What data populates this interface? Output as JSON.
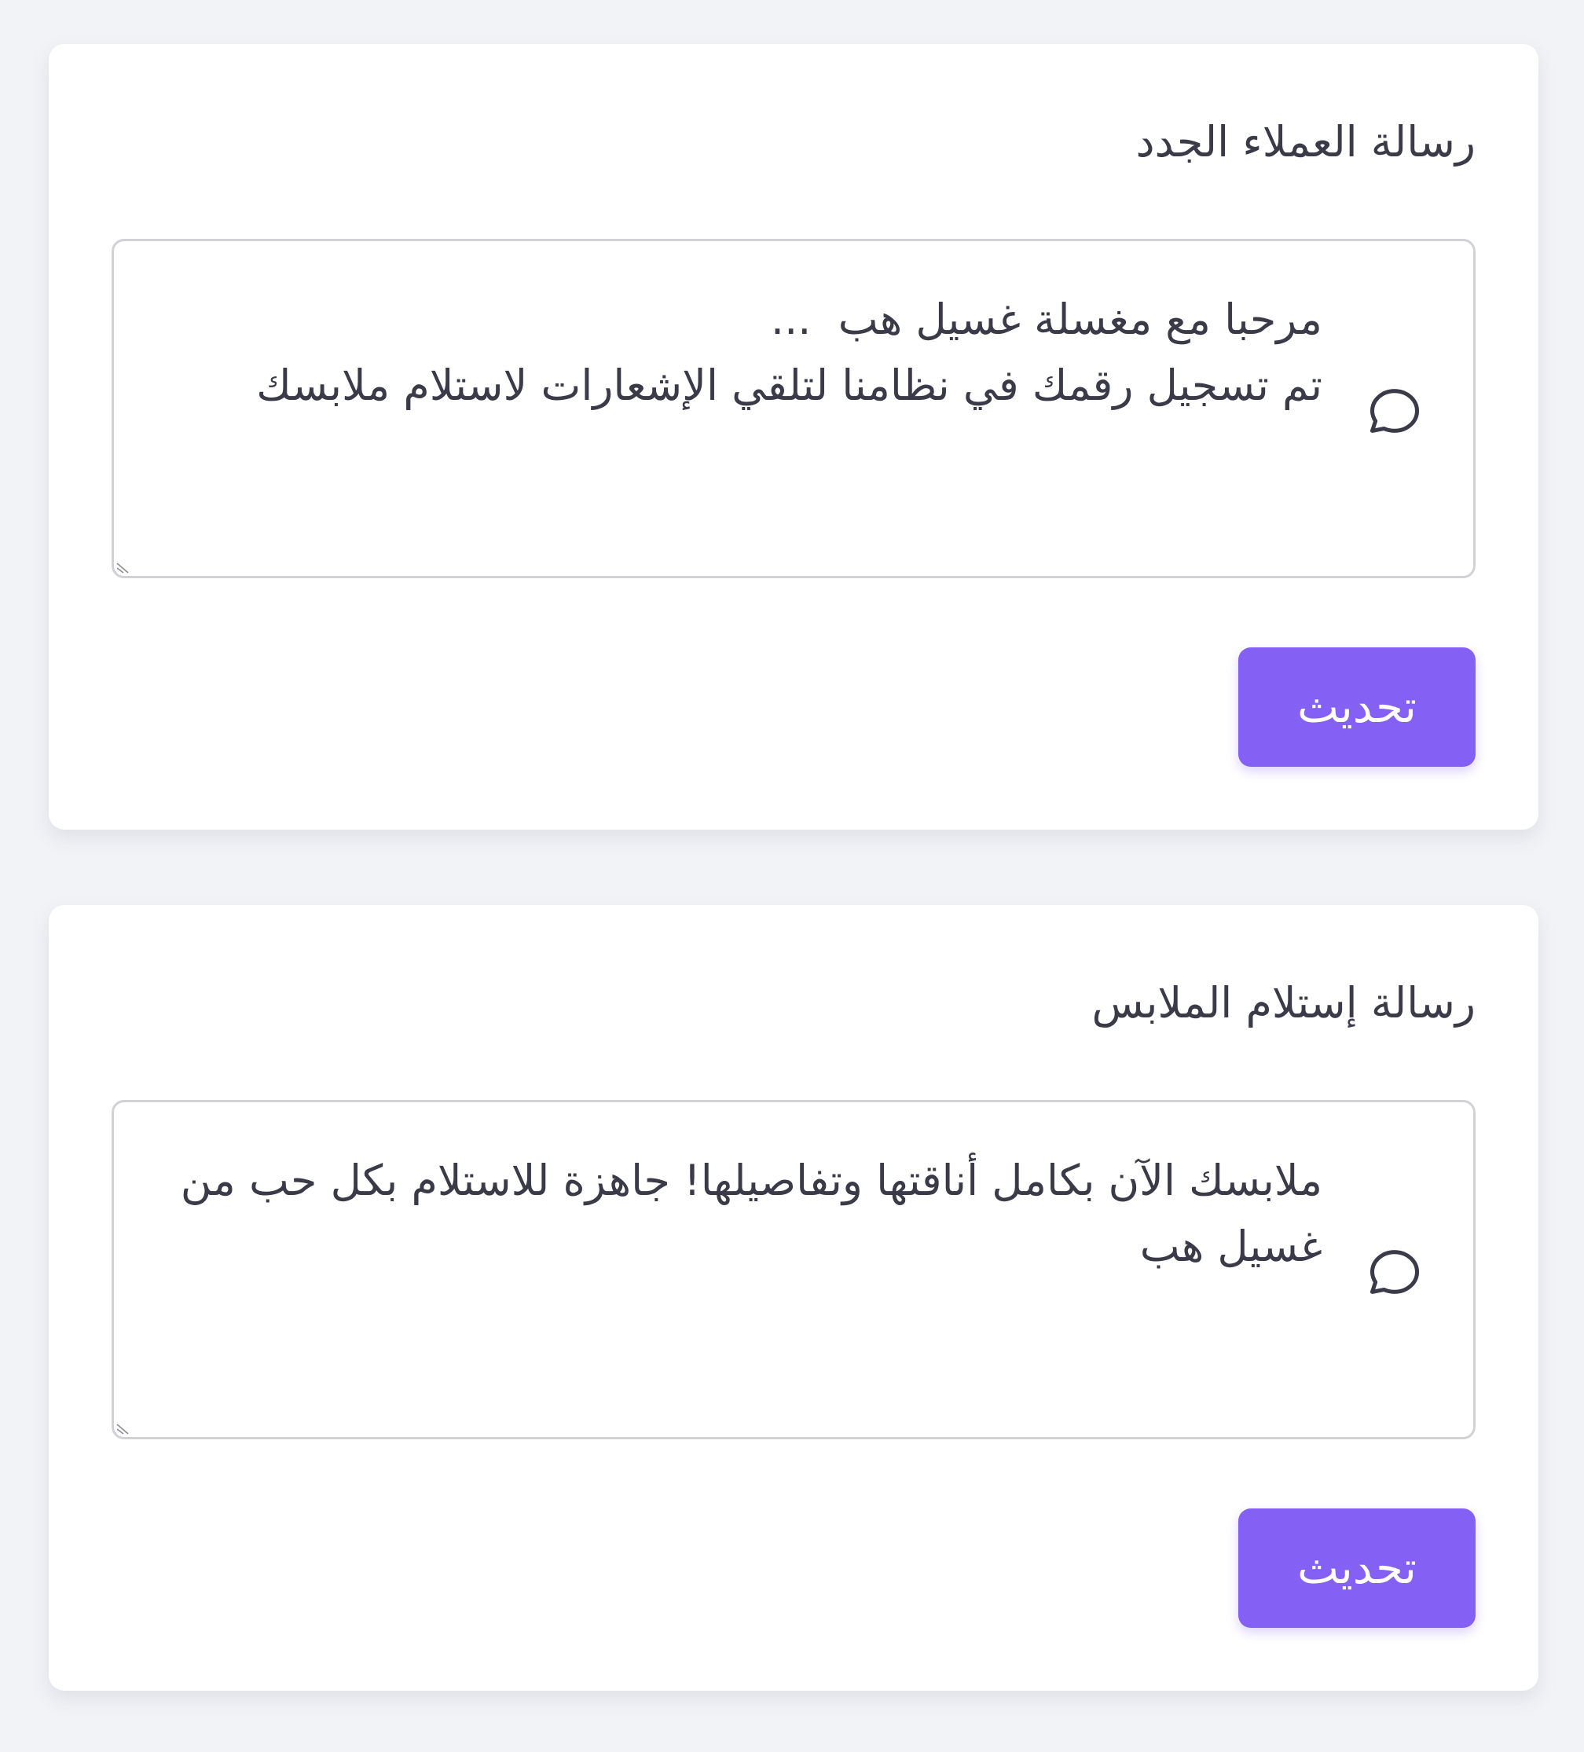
{
  "colors": {
    "page_background": "#f2f3f7",
    "card_background": "#ffffff",
    "text": "#3a3a48",
    "accent": "#8560f4",
    "input_border": "#d2d2d6"
  },
  "cards": [
    {
      "title": "رسالة العملاء الجدد",
      "message": "مرحبا مع مغسلة غسيل هب  ...\nتم تسجيل رقمك في نظامنا لتلقي الإشعارات لاستلام ملابسك",
      "icon": "chat-bubble-icon",
      "button_label": "تحديث"
    },
    {
      "title": "رسالة إستلام الملابس",
      "message": "ملابسك الآن بكامل أناقتها وتفاصيلها! جاهزة للاستلام بكل حب من غسيل هب",
      "icon": "chat-bubble-icon",
      "button_label": "تحديث"
    }
  ]
}
